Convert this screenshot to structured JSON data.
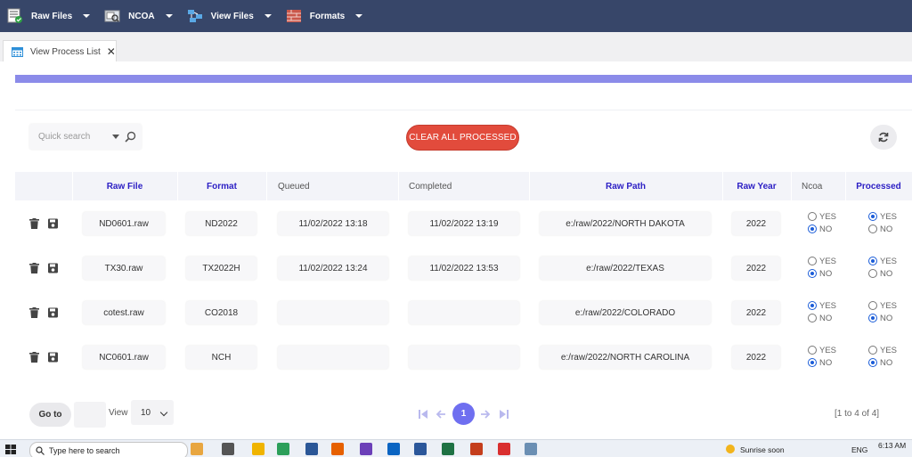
{
  "menubar": {
    "items": [
      {
        "label": "Raw Files",
        "icon": "raw-files-icon"
      },
      {
        "label": "NCOA",
        "icon": "ncoa-icon"
      },
      {
        "label": "View Files",
        "icon": "view-files-icon"
      },
      {
        "label": "Formats",
        "icon": "formats-icon"
      }
    ]
  },
  "tab": {
    "label": "View Process List",
    "close": "✕",
    "icon": "calculator-icon"
  },
  "toolbar": {
    "search_placeholder": "Quick search",
    "clear_label": "CLEAR ALL PROCESSED"
  },
  "columns": {
    "raw_file": "Raw File",
    "format": "Format",
    "queued": "Queued",
    "completed": "Completed",
    "raw_path": "Raw Path",
    "raw_year": "Raw Year",
    "ncoa": "Ncoa",
    "processed": "Processed"
  },
  "radio_labels": {
    "yes": "YES",
    "no": "NO"
  },
  "rows": [
    {
      "raw_file": "ND0601.raw",
      "format": "ND2022",
      "queued": "11/02/2022 13:18",
      "completed": "11/02/2022 13:19",
      "raw_path": "e:/raw/2022/NORTH DAKOTA",
      "raw_year": "2022",
      "ncoa": "NO",
      "processed": "YES"
    },
    {
      "raw_file": "TX30.raw",
      "format": "TX2022H",
      "queued": "11/02/2022 13:24",
      "completed": "11/02/2022 13:53",
      "raw_path": "e:/raw/2022/TEXAS",
      "raw_year": "2022",
      "ncoa": "NO",
      "processed": "YES"
    },
    {
      "raw_file": "cotest.raw",
      "format": "CO2018",
      "queued": "",
      "completed": "",
      "raw_path": "e:/raw/2022/COLORADO",
      "raw_year": "2022",
      "ncoa": "YES",
      "processed": "NO"
    },
    {
      "raw_file": "NC0601.raw",
      "format": "NCH",
      "queued": "",
      "completed": "",
      "raw_path": "e:/raw/2022/NORTH CAROLINA",
      "raw_year": "2022",
      "ncoa": "NO",
      "processed": "NO"
    }
  ],
  "footer": {
    "goto_label": "Go to",
    "view_label": "View",
    "page_size": "10",
    "current_page": "1",
    "range": "[1 to 4 of 4]"
  },
  "taskbar": {
    "search_placeholder": "Type here to search",
    "weather": "Sunrise soon",
    "lang": "ENG",
    "time": "6:13 AM"
  },
  "colors": {
    "menubar": "#374669",
    "accent": "#8b8be9",
    "danger": "#e24b3c",
    "header_blue": "#2b1ec4",
    "radio_blue": "#1a5cd8"
  }
}
